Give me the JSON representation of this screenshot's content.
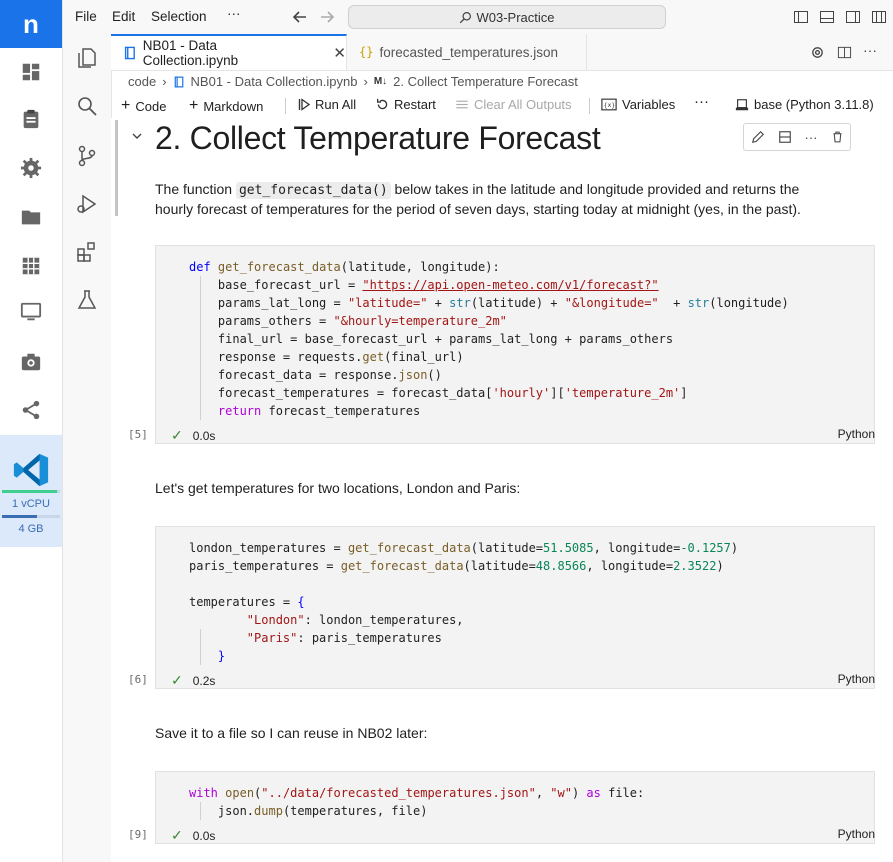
{
  "app": {
    "logo_letter": "n",
    "resources": {
      "cpu_label": "1 vCPU",
      "mem_label": "4 GB",
      "cpu_level": 0.95,
      "mem_level": 0.6
    }
  },
  "menubar": {
    "items": [
      "File",
      "Edit",
      "Selection"
    ],
    "more": "···",
    "search_text": "W03-Practice"
  },
  "tabs": [
    {
      "label": "NB01 - Data Collection.ipynb",
      "icon": "notebook-icon",
      "active": true
    },
    {
      "label": "forecasted_temperatures.json",
      "icon": "json-braces-icon",
      "active": false
    }
  ],
  "breadcrumb": {
    "root": "code",
    "file": "NB01 - Data Collection.ipynb",
    "md_badge": "M↓",
    "section": "2. Collect Temperature Forecast"
  },
  "toolbar": {
    "code": "Code",
    "markdown": "Markdown",
    "run_all": "Run All",
    "restart": "Restart",
    "clear_outputs": "Clear All Outputs",
    "variables": "Variables",
    "more": "···",
    "kernel": "base (Python 3.11.8)"
  },
  "notebook": {
    "heading": "2. Collect Temperature Forecast",
    "para1": {
      "before": "The function ",
      "code": "get_forecast_data()",
      "after_line1": " below takes in the latitude and longitude provided and returns the",
      "line2": "hourly forecast of temperatures for the period of seven days, starting today at midnight (yes, in the past)."
    },
    "cell1": {
      "count": "[5]",
      "time": "0.0s",
      "lang": "Python"
    },
    "para2": "Let's get temperatures for two locations, London and Paris:",
    "cell2": {
      "count": "[6]",
      "time": "0.2s",
      "lang": "Python"
    },
    "para3": "Save it to a file so I can reuse in NB02 later:",
    "cell3": {
      "count": "[9]",
      "time": "0.0s",
      "lang": "Python"
    }
  },
  "colors": {
    "accent": "#1a73e8",
    "success": "#388a34",
    "vscode_blue": "#0065a9"
  }
}
